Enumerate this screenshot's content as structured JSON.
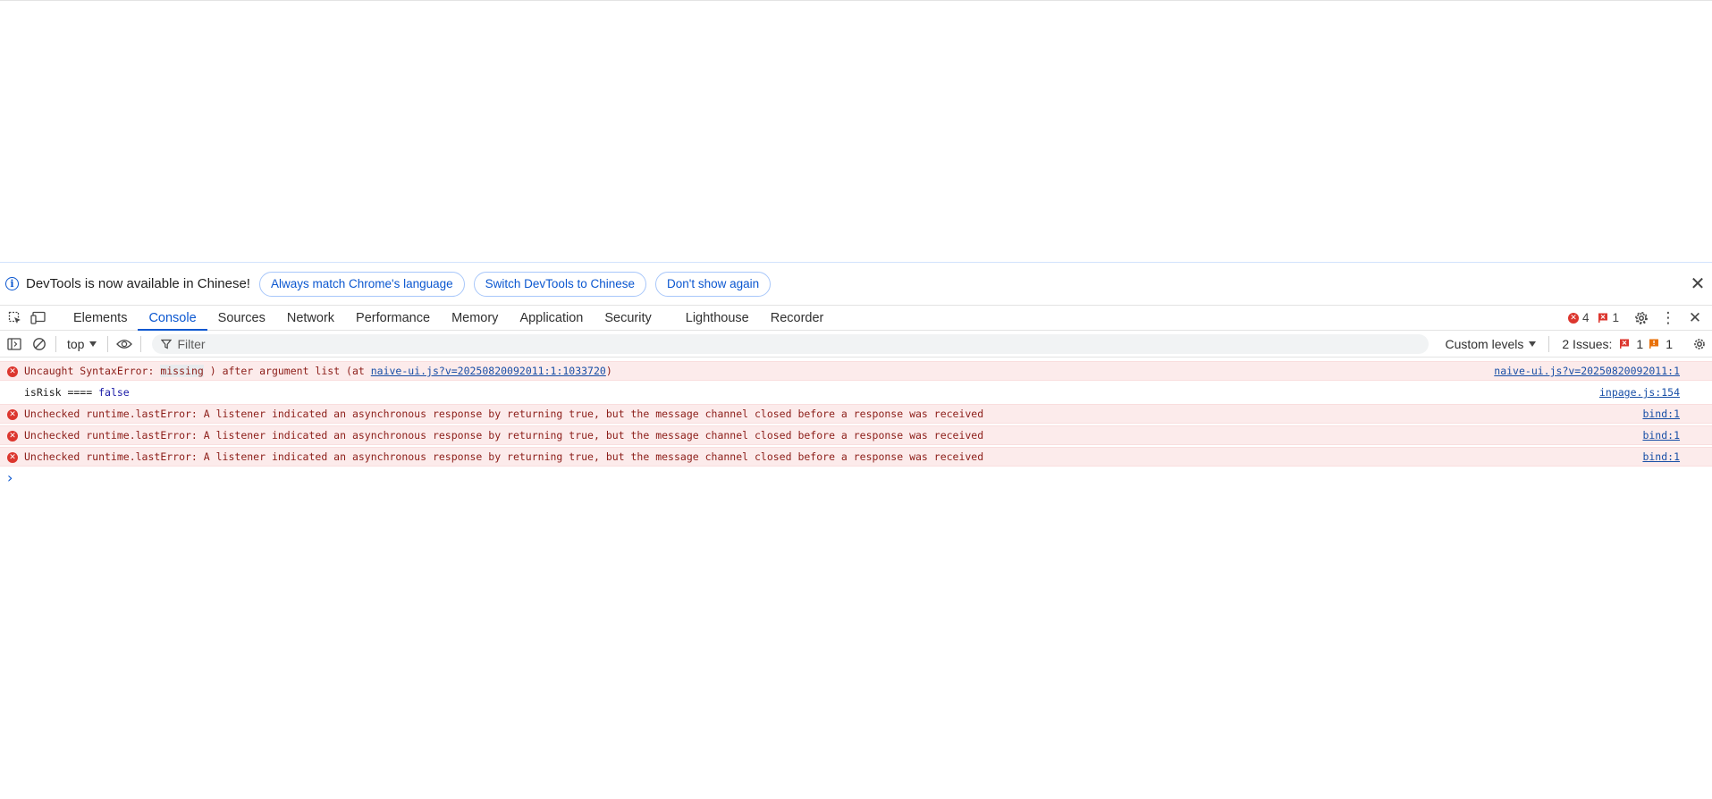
{
  "infobar": {
    "message": "DevTools is now available in Chinese!",
    "buttons": [
      "Always match Chrome's language",
      "Switch DevTools to Chinese",
      "Don't show again"
    ]
  },
  "tabs": [
    "Elements",
    "Console",
    "Sources",
    "Network",
    "Performance",
    "Memory",
    "Application",
    "Security",
    "Lighthouse",
    "Recorder"
  ],
  "active_tab": "Console",
  "counts": {
    "errors": "4",
    "warnings": "1"
  },
  "console_toolbar": {
    "context": "top",
    "filter_placeholder": "Filter",
    "levels": "Custom levels",
    "issues_label": "2 Issues:",
    "issues_errors": "1",
    "issues_warnings": "1"
  },
  "messages": [
    {
      "type": "error",
      "prefix": "Uncaught SyntaxError: ",
      "highlight": "missing",
      "middle": " ) after argument list (at ",
      "link": "naive-ui.js?v=20250820092011:1:1033720",
      "suffix": ")",
      "source": "naive-ui.js?v=20250820092011:1"
    },
    {
      "type": "log",
      "prefix": "isRisk ==== ",
      "value": "false",
      "source": "inpage.js:154"
    },
    {
      "type": "error",
      "text": "Unchecked runtime.lastError: A listener indicated an asynchronous response by returning true, but the message channel closed before a response was received",
      "source": "bind:1"
    },
    {
      "type": "error",
      "text": "Unchecked runtime.lastError: A listener indicated an asynchronous response by returning true, but the message channel closed before a response was received",
      "source": "bind:1"
    },
    {
      "type": "error",
      "text": "Unchecked runtime.lastError: A listener indicated an asynchronous response by returning true, but the message channel closed before a response was received",
      "source": "bind:1"
    }
  ],
  "colors": {
    "accent": "#0b57d0",
    "error": "#dc362e",
    "error_bg": "#fcebeb",
    "warning": "#e8710a"
  }
}
